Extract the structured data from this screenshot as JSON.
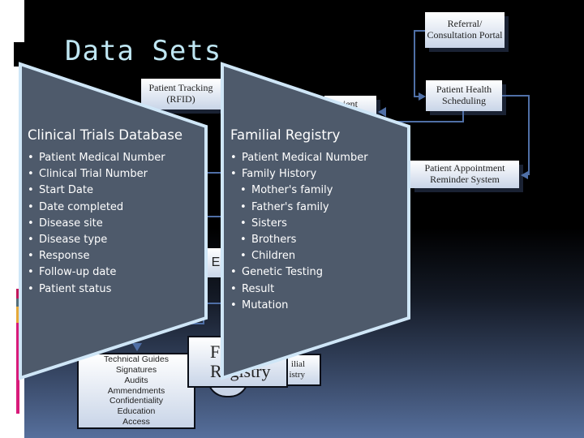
{
  "slide": {
    "title": "Data Sets"
  },
  "diagram": {
    "boxes": {
      "referral": [
        "Referral/",
        "Consultation Portal"
      ],
      "patient_tracking": [
        "Patient Tracking",
        "(RFID)"
      ],
      "patient_health_scheduling": [
        "Patient Health",
        "Scheduling"
      ],
      "patient_partial": "ient",
      "appointment_reminder": [
        "Patient Appointment",
        "Reminder System"
      ],
      "partial_e": "E",
      "guidelines": [
        "Technical Guides",
        "Signatures",
        "Audits",
        "Ammendments",
        "Confidentiality",
        "Education",
        "Access"
      ],
      "registry_large": [
        "F",
        "Registry"
      ],
      "familial_small": [
        "ilial",
        "istry"
      ]
    },
    "colors": {
      "connector": "#4f6fa6",
      "box_fill_top": "#ffffff",
      "box_fill_bottom": "#c9d5e8"
    }
  },
  "panels": {
    "clinical_trials": {
      "title": "Clinical Trials Database",
      "items": [
        {
          "label": "Patient Medical Number",
          "level": 1
        },
        {
          "label": "Clinical Trial Number",
          "level": 1
        },
        {
          "label": "Start Date",
          "level": 1
        },
        {
          "label": "Date completed",
          "level": 1
        },
        {
          "label": "Disease site",
          "level": 1
        },
        {
          "label": "Disease type",
          "level": 1
        },
        {
          "label": "Response",
          "level": 1
        },
        {
          "label": "Follow-up date",
          "level": 1
        },
        {
          "label": "Patient status",
          "level": 1
        }
      ]
    },
    "familial_registry": {
      "title": "Familial Registry",
      "items": [
        {
          "label": "Patient Medical Number",
          "level": 1
        },
        {
          "label": "Family History",
          "level": 1
        },
        {
          "label": "Mother's family",
          "level": 2
        },
        {
          "label": "Father's family",
          "level": 2
        },
        {
          "label": "Sisters",
          "level": 2
        },
        {
          "label": "Brothers",
          "level": 2
        },
        {
          "label": "Children",
          "level": 2
        },
        {
          "label": "Genetic Testing",
          "level": 1
        },
        {
          "label": "Result",
          "level": 1
        },
        {
          "label": "Mutation",
          "level": 1
        }
      ]
    },
    "colors": {
      "panel_fill": "#4e5a6b",
      "panel_border": "#cfe6f7",
      "title_color": "#bfe6f2"
    }
  },
  "accent_strip_colors": [
    "#c2185b",
    "#546e7a",
    "#e6a93a",
    "#d81b7a"
  ]
}
